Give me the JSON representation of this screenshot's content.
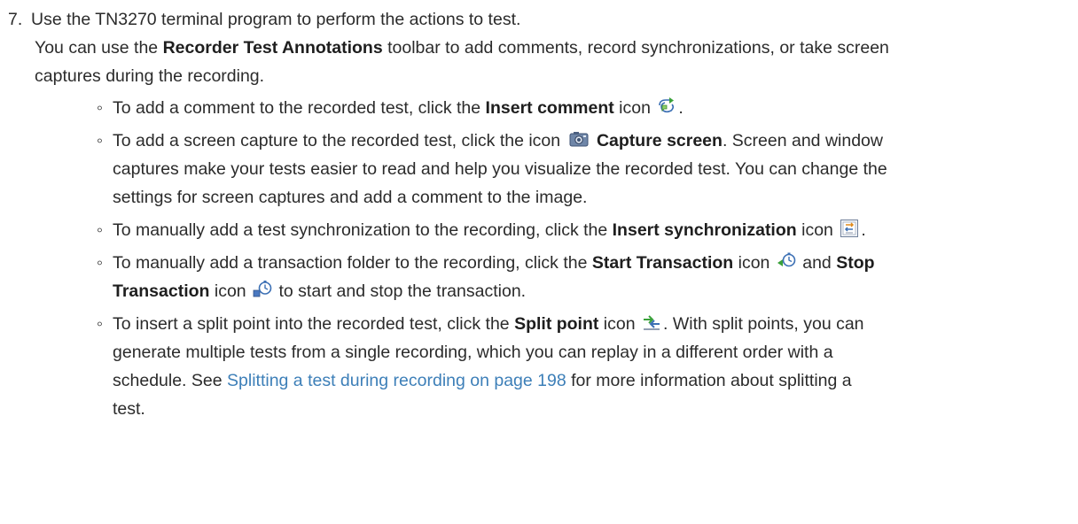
{
  "step": {
    "number": "7.",
    "title": "Use the TN3270 terminal program to perform the actions to test.",
    "intro": {
      "pre": "You can use the ",
      "bold": "Recorder Test Annotations",
      "line1_post": " toolbar to add comments, record synchronizations, or take screen",
      "line2": "captures during the recording."
    }
  },
  "bullets": [
    {
      "pre": "To add a comment to the recorded test, click the ",
      "bold": "Insert comment",
      "post": " icon",
      "end": ".",
      "icon": "insert-comment-icon"
    },
    {
      "pre": "To add a screen capture to the recorded test, click the icon",
      "bold": "Capture screen",
      "line1_post": ". Screen and window",
      "line2": "captures make your tests easier to read and help you visualize the recorded test. You can change the",
      "line3": "settings for screen captures and add a comment to the image.",
      "icon": "capture-screen-icon"
    },
    {
      "pre": "To manually add a test synchronization to the recording, click the ",
      "bold": "Insert synchronization",
      "post": " icon",
      "end": ".",
      "icon": "insert-synchronization-icon"
    },
    {
      "pre": "To manually add a transaction folder to the recording, click the ",
      "bold1": "Start Transaction",
      "mid": " icon",
      "mid2": " and ",
      "bold2a": "Stop",
      "bold2b": "Transaction",
      "post2": " icon",
      "end": " to start and stop the transaction.",
      "icon1": "start-transaction-icon",
      "icon2": "stop-transaction-icon"
    },
    {
      "pre": "To insert a split point into the recorded test, click the ",
      "bold": "Split point",
      "post": " icon",
      "post_b": ". With split points, you can",
      "line2": "generate multiple tests from a single recording, which you can replay in a different order with a",
      "line3_pre": "schedule. See ",
      "link": "Splitting a test during recording on page 198",
      "line3_post": " for more information about splitting a",
      "line4": "test.",
      "icon": "split-point-icon"
    }
  ],
  "bullet_marker": "◦",
  "colors": {
    "text": "#2b2b2b",
    "link": "#3d7fb8"
  }
}
